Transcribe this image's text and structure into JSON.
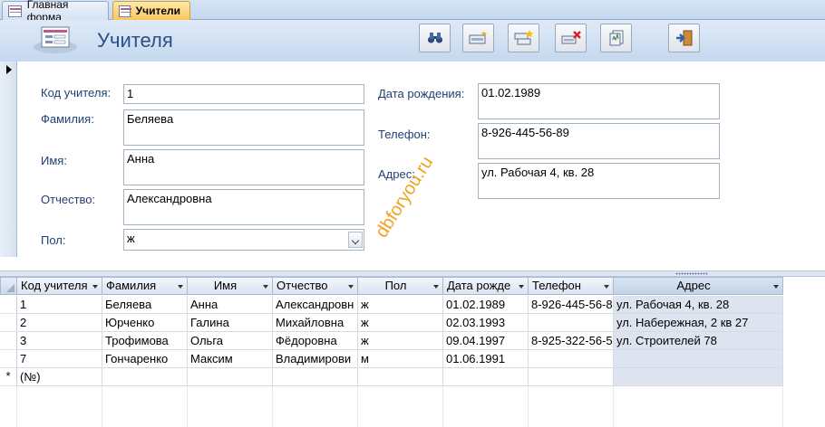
{
  "tabs": [
    {
      "label": "Главная форма",
      "active": false
    },
    {
      "label": "Учители",
      "active": true
    }
  ],
  "form": {
    "title": "Учителя",
    "toolbar": [
      {
        "name": "find-button",
        "icon": "binoculars-icon"
      },
      {
        "name": "edit-record-button",
        "icon": "edit-record-icon"
      },
      {
        "name": "new-record-button",
        "icon": "new-record-icon"
      },
      {
        "name": "delete-record-button",
        "icon": "delete-record-icon"
      },
      {
        "name": "save-record-button",
        "icon": "save-icon"
      },
      {
        "name": "close-form-button",
        "icon": "exit-door-icon"
      }
    ],
    "fields": {
      "teacher_id": {
        "label": "Код учителя:",
        "value": "1"
      },
      "last_name": {
        "label": "Фамилия:",
        "value": "Беляева"
      },
      "first_name": {
        "label": "Имя:",
        "value": "Анна"
      },
      "patronymic": {
        "label": "Отчество:",
        "value": "Александровна"
      },
      "gender": {
        "label": "Пол:",
        "value": "ж"
      },
      "birth_date": {
        "label": "Дата рождения:",
        "value": "01.02.1989"
      },
      "phone": {
        "label": "Телефон:",
        "value": "8-926-445-56-89"
      },
      "address": {
        "label": "Адрес:",
        "value": "ул. Рабочая 4, кв. 28"
      }
    }
  },
  "watermark": "dbforyou.ru",
  "datasheet": {
    "columns": [
      "Код учителя",
      "Фамилия",
      "Имя",
      "Отчество",
      "Пол",
      "Дата рожде",
      "Телефон",
      "Адрес"
    ],
    "rows": [
      [
        "1",
        "Беляева",
        "Анна",
        "Александровн",
        "ж",
        "01.02.1989",
        "8-926-445-56-8",
        "ул. Рабочая 4, кв. 28"
      ],
      [
        "2",
        "Юрченко",
        "Галина",
        "Михайловна",
        "ж",
        "02.03.1993",
        "",
        "ул. Набережная, 2 кв 27"
      ],
      [
        "3",
        "Трофимова",
        "Ольга",
        "Фёдоровна",
        "ж",
        "09.04.1997",
        "8-925-322-56-5",
        "ул. Строителей 78"
      ],
      [
        "7",
        "Гончаренко",
        "Максим",
        "Владимирови",
        "м",
        "01.06.1991",
        "",
        ""
      ]
    ],
    "new_row_marker": "*",
    "new_row_placeholder": "(№)"
  },
  "colors": {
    "accent_tab": "#f9c65c",
    "header_bg": "#c5d8ef",
    "label_text": "#1f3f73",
    "title_text": "#2c4f86"
  }
}
